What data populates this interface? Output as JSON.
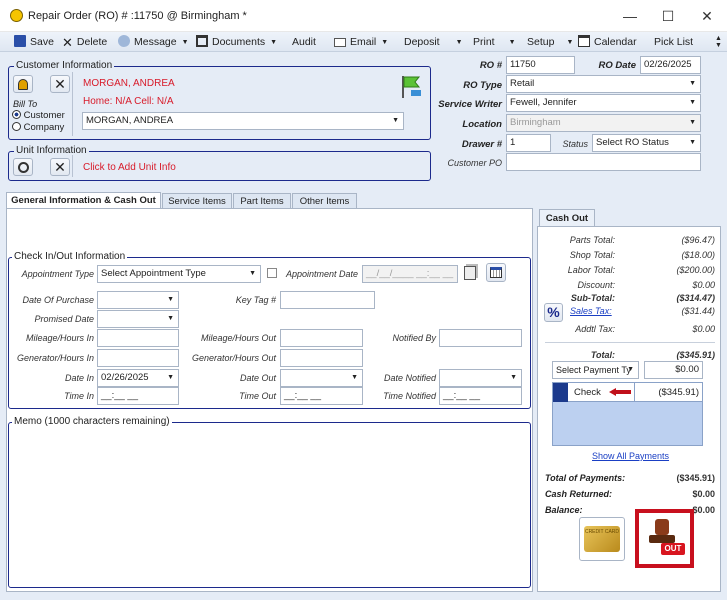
{
  "window": {
    "title": "Repair Order (RO) # :11750 @ Birmingham *"
  },
  "toolbar": {
    "save": "Save",
    "delete": "Delete",
    "message": "Message",
    "documents": "Documents",
    "audit": "Audit",
    "email": "Email",
    "deposit": "Deposit",
    "print": "Print",
    "setup": "Setup",
    "calendar": "Calendar",
    "pick_list": "Pick List"
  },
  "customer": {
    "group": "Customer Information",
    "bill_to": "Bill To",
    "opt_customer": "Customer",
    "opt_company": "Company",
    "name": "MORGAN, ANDREA",
    "phones": "Home: N/A  Cell: N/A",
    "select_value": "MORGAN, ANDREA"
  },
  "unit": {
    "group": "Unit Information",
    "add_link": "Click to Add Unit Info"
  },
  "ro": {
    "ro_label": "RO #",
    "ro_value": "11750",
    "date_label": "RO Date",
    "date_value": "02/26/2025",
    "type_label": "RO Type",
    "type_value": "Retail",
    "writer_label": "Service Writer",
    "writer_value": "Fewell, Jennifer",
    "location_label": "Location",
    "location_value": "Birmingham",
    "drawer_label": "Drawer #",
    "drawer_value": "1",
    "status_label": "Status",
    "status_value": "Select RO Status",
    "po_label": "Customer PO",
    "po_value": ""
  },
  "tabs": [
    "General Information & Cash Out",
    "Service Items",
    "Part Items",
    "Other Items"
  ],
  "checkio": {
    "group": "Check In/Out Information",
    "appt_type_label": "Appointment Type",
    "appt_type_value": "Select Appointment Type",
    "appt_date_label": "Appointment Date",
    "appt_date_value": "__/__/____ __:__ __",
    "purchase_label": "Date Of Purchase",
    "keytag_label": "Key Tag #",
    "promised_label": "Promised Date",
    "mileage_in_label": "Mileage/Hours In",
    "mileage_out_label": "Mileage/Hours Out",
    "notified_by_label": "Notified By",
    "gen_in_label": "Generator/Hours In",
    "gen_out_label": "Generator/Hours Out",
    "date_in_label": "Date In",
    "date_in_value": "02/26/2025",
    "date_out_label": "Date Out",
    "date_notified_label": "Date Notified",
    "time_in_label": "Time In",
    "time_in_value": "__:__ __",
    "time_out_label": "Time Out",
    "time_out_value": "__:__ __",
    "time_notified_label": "Time Notified",
    "time_notified_value": "__:__ __"
  },
  "memo": {
    "label": "Memo (1000 characters remaining)"
  },
  "cashout": {
    "tab": "Cash Out",
    "rows": [
      [
        "Parts Total:",
        "($96.47)"
      ],
      [
        "Shop Total:",
        "($18.00)"
      ],
      [
        "Labor Total:",
        "($200.00)"
      ],
      [
        "Discount:",
        "$0.00"
      ]
    ],
    "subtotal_label": "Sub-Total:",
    "subtotal_value": "($314.47)",
    "tax_label": "Sales Tax:",
    "tax_value": "($31.44)",
    "addtl_label": "Addtl Tax:",
    "addtl_value": "$0.00",
    "total_label": "Total:",
    "total_value": "($345.91)",
    "payment_select": "Select Payment Ty",
    "payment_amount": "$0.00",
    "payment_method": "Check",
    "payment_value": "($345.91)",
    "show_all": "Show All Payments",
    "tot_pay_label": "Total of Payments:",
    "tot_pay_value": "($345.91)",
    "cash_ret_label": "Cash Returned:",
    "cash_ret_value": "$0.00",
    "balance_label": "Balance:",
    "balance_value": "$0.00",
    "card_text": "CREDIT CARD",
    "stamp_text": "OUT"
  }
}
